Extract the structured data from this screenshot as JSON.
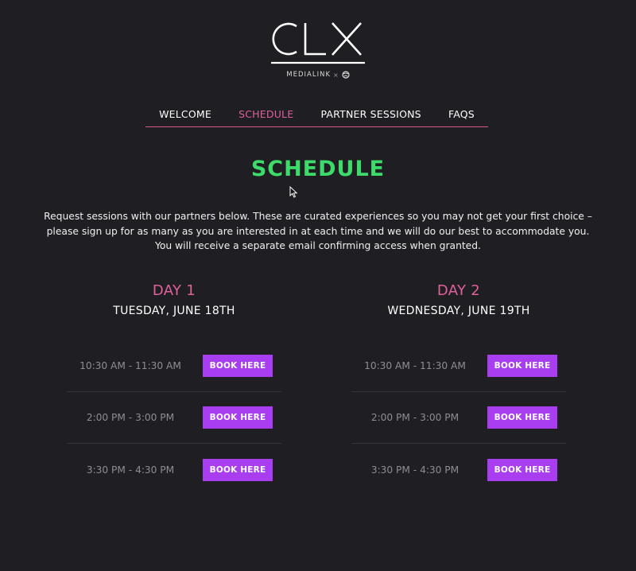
{
  "brand": {
    "logo_text": "CLX",
    "sub_brand": "MEDIALINK",
    "sub_separator": "×"
  },
  "nav": {
    "items": [
      {
        "label": "WELCOME",
        "active": false
      },
      {
        "label": "SCHEDULE",
        "active": true
      },
      {
        "label": "PARTNER SESSIONS",
        "active": false
      },
      {
        "label": "FAQS",
        "active": false
      }
    ]
  },
  "main": {
    "title": "SCHEDULE",
    "intro": "Request sessions with our partners below. These are curated experiences so you may not get your first choice – please sign up for as many as you are interested in at each time and we will do our best to accommodate you. You will receive a separate email confirming access when granted."
  },
  "days": [
    {
      "day_label": "DAY 1",
      "date": "TUESDAY, JUNE 18TH",
      "slots": [
        {
          "time": "10:30 AM - 11:30 AM",
          "button": "BOOK HERE"
        },
        {
          "time": "2:00 PM - 3:00 PM",
          "button": "BOOK HERE"
        },
        {
          "time": "3:30 PM - 4:30 PM",
          "button": "BOOK HERE"
        }
      ]
    },
    {
      "day_label": "DAY 2",
      "date": "WEDNESDAY, JUNE 19TH",
      "slots": [
        {
          "time": "10:30 AM - 11:30 AM",
          "button": "BOOK HERE"
        },
        {
          "time": "2:00 PM - 3:00 PM",
          "button": "BOOK HERE"
        },
        {
          "time": "3:30 PM - 4:30 PM",
          "button": "BOOK HERE"
        }
      ]
    }
  ],
  "colors": {
    "background": "#1f1f23",
    "accent_pink": "#e0609a",
    "accent_green": "#3ddc6a",
    "button_purple": "#a93ef0"
  }
}
